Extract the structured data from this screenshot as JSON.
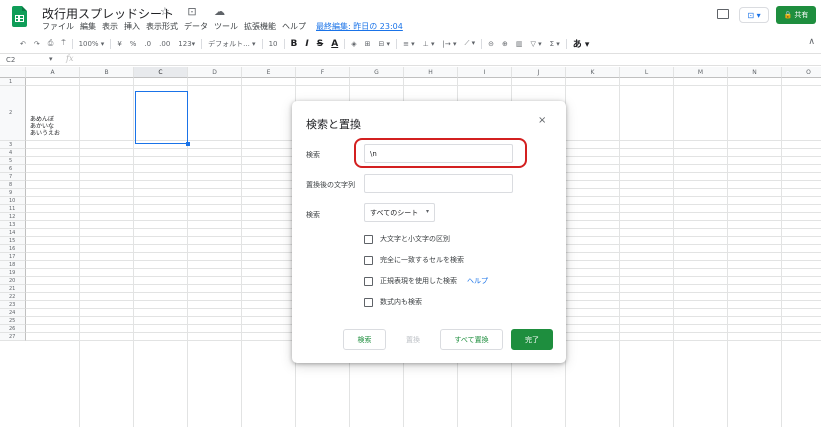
{
  "app": {
    "title": "改行用スプレッドシート",
    "title_icons": "☆ ⊡ ☁",
    "menu": [
      "ファイル",
      "編集",
      "表示",
      "挿入",
      "表示形式",
      "データ",
      "ツール",
      "拡張機能",
      "ヘルプ"
    ],
    "last_edit": "最終編集: 昨日の 23:04",
    "present_label": "⊡ ▾",
    "share_label": "共有",
    "share_icon": "lock-icon"
  },
  "toolbar": {
    "undo": "↶",
    "redo": "↷",
    "print": "⎙",
    "paint_format": "⍑",
    "zoom": "100% ▾",
    "currency": "¥",
    "percent": "%",
    "decimal_decrease": ".0",
    "decimal_increase": ".00",
    "format_more": "123▾",
    "font": "デフォルト... ▾",
    "font_size": "10",
    "bold": "B",
    "italic": "I",
    "strike": "S",
    "text_color": "A",
    "fill": "◈",
    "borders": "⊞",
    "merge": "⊟ ▾",
    "halign": "≡ ▾",
    "valign": "⊥ ▾",
    "wrap": "|→ ▾",
    "rotate": "⟋ ▾",
    "link": "⊝",
    "comment": "⊕",
    "chart": "▥",
    "filter": "▽ ▾",
    "functions": "Σ ▾",
    "input_tools": "あ ▾",
    "collapse": "∧"
  },
  "formula_bar": {
    "cell_ref": "C2",
    "dropdown": "▾",
    "fx": "fx"
  },
  "columns": [
    "A",
    "B",
    "C",
    "D",
    "E",
    "F",
    "G",
    "H",
    "I",
    "J",
    "K",
    "L",
    "M",
    "N",
    "O"
  ],
  "selected_column": "C",
  "rows": [
    "1",
    "2",
    "3",
    "4",
    "5",
    "6",
    "7",
    "8",
    "9",
    "10",
    "11",
    "12",
    "13",
    "14",
    "15",
    "16",
    "17",
    "18",
    "19",
    "20",
    "21",
    "22",
    "23",
    "24",
    "25",
    "26",
    "27"
  ],
  "cell_A2": [
    "あめんぼ",
    "あかいな",
    "あいうえお"
  ],
  "dialog": {
    "title": "検索と置換",
    "close": "×",
    "find_label": "検索",
    "find_value": "\\n",
    "replace_label": "置換後の文字列",
    "replace_value": "",
    "search_label": "検索",
    "search_scope": "すべてのシート",
    "options": [
      {
        "label": "大文字と小文字の区別",
        "checked": false
      },
      {
        "label": "完全に一致するセルを検索",
        "checked": false
      },
      {
        "label": "正規表現を使用した検索",
        "checked": false,
        "help": "ヘルプ"
      },
      {
        "label": "数式内も検索",
        "checked": false
      }
    ],
    "buttons": {
      "find": "検索",
      "replace": "置換",
      "replace_all": "すべて置換",
      "done": "完了"
    }
  },
  "colors": {
    "accent_green": "#1e8e3e",
    "selection_blue": "#1a73e8",
    "highlight_red": "#d32020"
  }
}
